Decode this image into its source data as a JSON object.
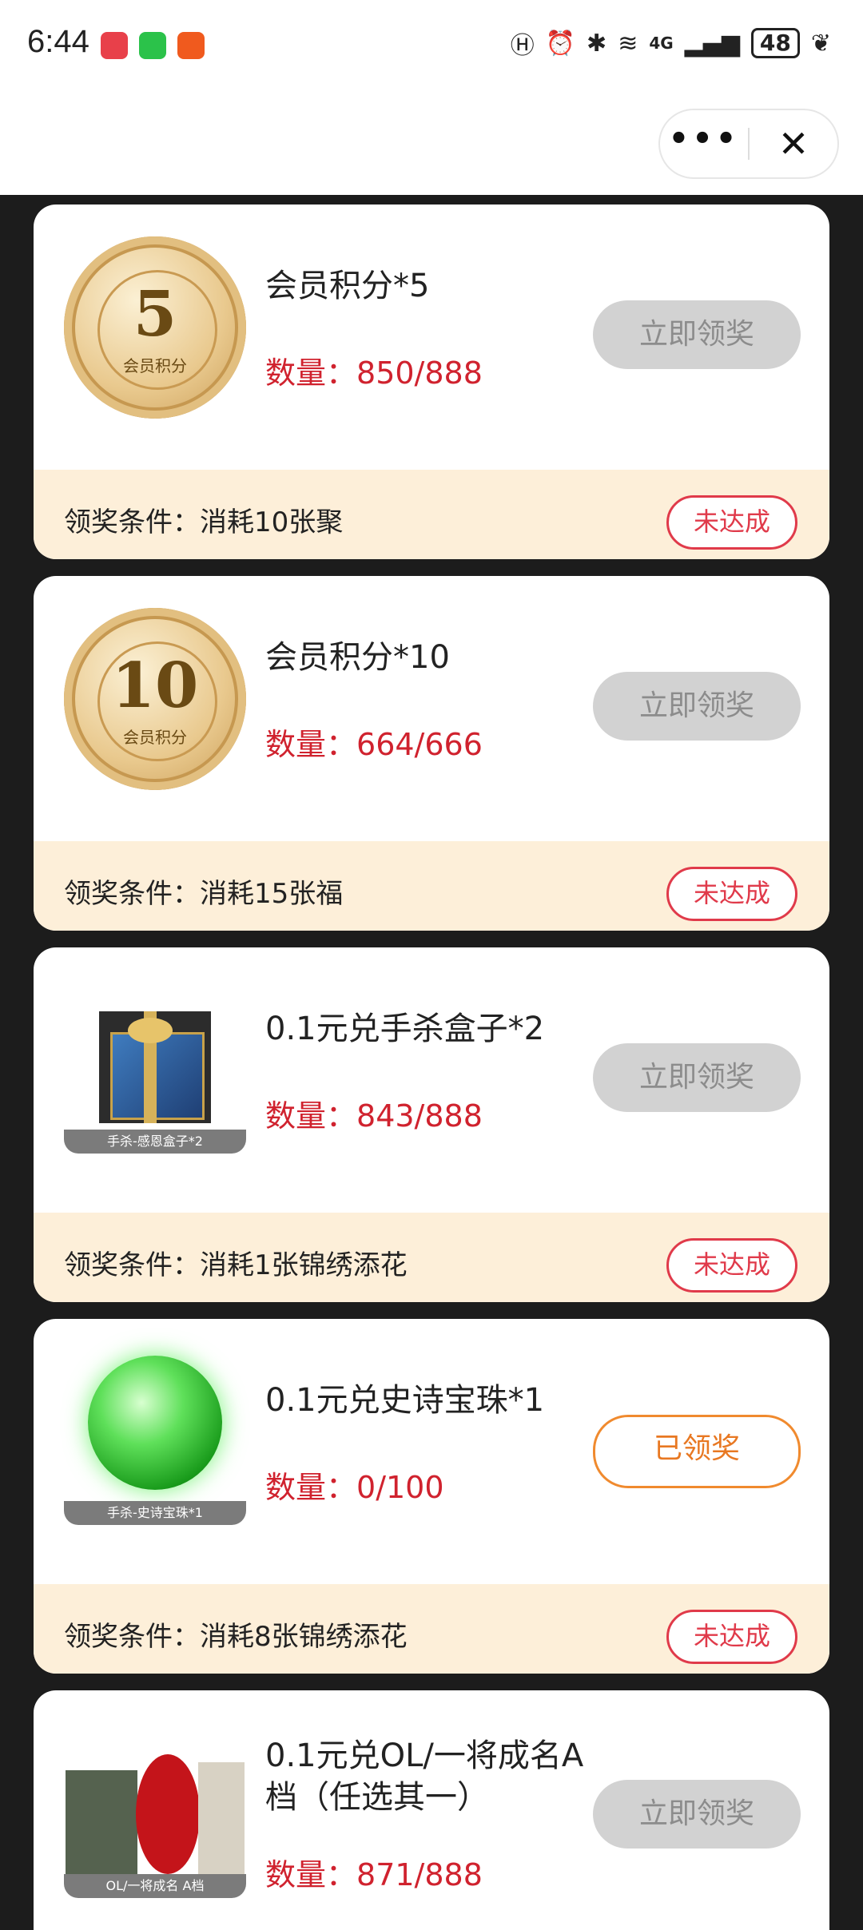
{
  "status_bar": {
    "time": "6:44",
    "battery": "48",
    "network": "4G"
  },
  "top_bar": {
    "more_icon": "more-dots-icon",
    "close_icon": "close-icon"
  },
  "cards": [
    {
      "thumb": {
        "type": "coin",
        "number": "5",
        "label": "会员积分"
      },
      "title": "会员积分*5",
      "quantity_label": "数量：",
      "quantity": "850/888",
      "button": "立即领奖",
      "button_state": "disabled",
      "condition_label": "领奖条件：",
      "condition": "消耗10张聚",
      "status": "未达成"
    },
    {
      "thumb": {
        "type": "coin",
        "number": "10",
        "label": "会员积分"
      },
      "title": "会员积分*10",
      "quantity_label": "数量：",
      "quantity": "664/666",
      "button": "立即领奖",
      "button_state": "disabled",
      "condition_label": "领奖条件：",
      "condition": "消耗15张福",
      "status": "未达成"
    },
    {
      "thumb": {
        "type": "gift",
        "caption": "手杀-感恩盒子*2"
      },
      "title": "0.1元兑手杀盒子*2",
      "quantity_label": "数量：",
      "quantity": "843/888",
      "button": "立即领奖",
      "button_state": "disabled",
      "condition_label": "领奖条件：",
      "condition": "消耗1张锦绣添花",
      "status": "未达成"
    },
    {
      "thumb": {
        "type": "orb",
        "caption": "手杀-史诗宝珠*1"
      },
      "title": "0.1元兑史诗宝珠*1",
      "quantity_label": "数量：",
      "quantity": "0/100",
      "button": "已领奖",
      "button_state": "claimed",
      "condition_label": "领奖条件：",
      "condition": "消耗8张锦绣添花",
      "status": "未达成"
    },
    {
      "thumb": {
        "type": "multi",
        "caption": "OL/一将成名 A档"
      },
      "title": "0.1元兑OL/一将成名A档（任选其一）",
      "quantity_label": "数量：",
      "quantity": "871/888",
      "button": "立即领奖",
      "button_state": "disabled"
    }
  ]
}
